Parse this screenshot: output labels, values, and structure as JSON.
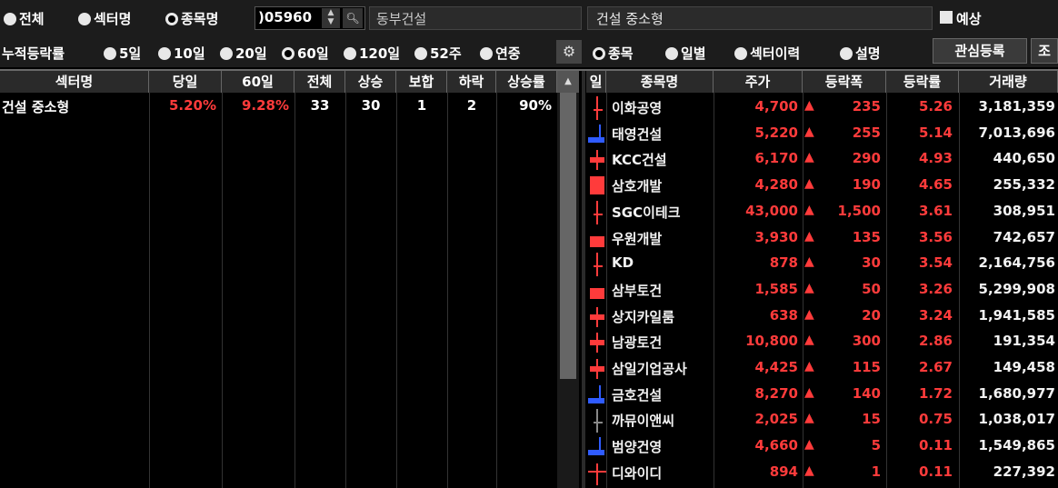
{
  "toolbar": {
    "mode_radios": [
      {
        "label": "전체",
        "selected": false
      },
      {
        "label": "섹터명",
        "selected": false
      },
      {
        "label": "종목명",
        "selected": true
      }
    ],
    "code_value": ")05960",
    "stock_name": "동부건설",
    "sector_name": "건설 중소형",
    "forecast_label": "예상",
    "forecast_checked": true
  },
  "period_bar": {
    "label": "누적등락률",
    "periods": [
      {
        "label": "5일",
        "selected": false
      },
      {
        "label": "10일",
        "selected": false
      },
      {
        "label": "20일",
        "selected": false
      },
      {
        "label": "60일",
        "selected": true
      },
      {
        "label": "120일",
        "selected": false
      },
      {
        "label": "52주",
        "selected": false
      },
      {
        "label": "연중",
        "selected": false
      }
    ],
    "view_radios": [
      {
        "label": "종목",
        "selected": true
      },
      {
        "label": "일별",
        "selected": false
      },
      {
        "label": "섹터이력",
        "selected": false
      },
      {
        "label": "설명",
        "selected": false
      }
    ],
    "watchlist_button": "관심등록",
    "extra_button": "조"
  },
  "sector_table": {
    "headers": [
      "섹터명",
      "당일",
      "60일",
      "전체",
      "상승",
      "보합",
      "하락",
      "상승률"
    ],
    "rows": [
      {
        "name": "건설 중소형",
        "today": "5.20%",
        "period": "9.28%",
        "total": "33",
        "up": "30",
        "flat": "1",
        "down": "2",
        "up_ratio": "90%"
      }
    ]
  },
  "stock_table": {
    "headers": [
      "일",
      "종목명",
      "주가",
      "등락폭",
      "등락률",
      "거래량"
    ],
    "up_marker": "▲",
    "colors": {
      "up": "#ff3b3b",
      "down": "#2f5bff",
      "text": "#f2f2f2"
    },
    "rows": [
      {
        "name": "이화공영",
        "price": "4,700",
        "change": "235",
        "rate": "5.26",
        "volume": "3,181,359"
      },
      {
        "name": "태영건설",
        "price": "5,220",
        "change": "255",
        "rate": "5.14",
        "volume": "7,013,696"
      },
      {
        "name": "KCC건설",
        "price": "6,170",
        "change": "290",
        "rate": "4.93",
        "volume": "440,650"
      },
      {
        "name": "삼호개발",
        "price": "4,280",
        "change": "190",
        "rate": "4.65",
        "volume": "255,332"
      },
      {
        "name": "SGC이테크",
        "price": "43,000",
        "change": "1,500",
        "rate": "3.61",
        "volume": "308,951"
      },
      {
        "name": "우원개발",
        "price": "3,930",
        "change": "135",
        "rate": "3.56",
        "volume": "742,657"
      },
      {
        "name": "KD",
        "price": "878",
        "change": "30",
        "rate": "3.54",
        "volume": "2,164,756"
      },
      {
        "name": "삼부토건",
        "price": "1,585",
        "change": "50",
        "rate": "3.26",
        "volume": "5,299,908"
      },
      {
        "name": "상지카일룸",
        "price": "638",
        "change": "20",
        "rate": "3.24",
        "volume": "1,941,585"
      },
      {
        "name": "남광토건",
        "price": "10,800",
        "change": "300",
        "rate": "2.86",
        "volume": "191,354"
      },
      {
        "name": "삼일기업공사",
        "price": "4,425",
        "change": "115",
        "rate": "2.67",
        "volume": "149,458"
      },
      {
        "name": "금호건설",
        "price": "8,270",
        "change": "140",
        "rate": "1.72",
        "volume": "1,680,977"
      },
      {
        "name": "까뮤이앤씨",
        "price": "2,025",
        "change": "15",
        "rate": "0.75",
        "volume": "1,038,017"
      },
      {
        "name": "범양건영",
        "price": "4,660",
        "change": "5",
        "rate": "0.11",
        "volume": "1,549,865"
      },
      {
        "name": "디와이디",
        "price": "894",
        "change": "1",
        "rate": "0.11",
        "volume": "227,392"
      }
    ]
  }
}
